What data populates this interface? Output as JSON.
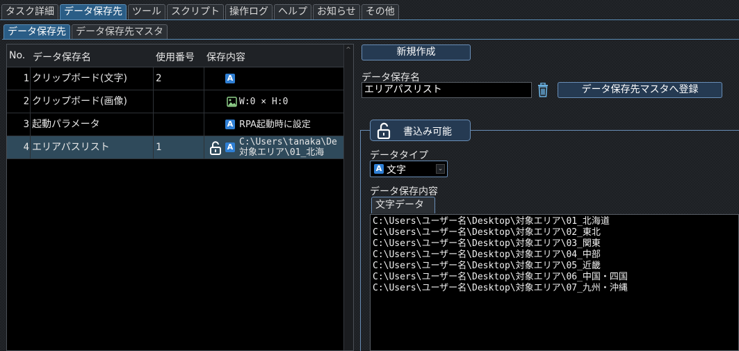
{
  "tabs": [
    "タスク詳細",
    "データ保存先",
    "ツール",
    "スクリプト",
    "操作ログ",
    "ヘルプ",
    "お知らせ",
    "その他"
  ],
  "subtabs": [
    "データ保存先",
    "データ保存先マスタ"
  ],
  "table": {
    "headers": {
      "no": "No.",
      "name": "データ保存名",
      "num": "使用番号",
      "content": "保存内容"
    },
    "rows": [
      {
        "no": "1",
        "name": "クリップボード(文字)",
        "num": "2",
        "icon": "text-type-icon",
        "content": ""
      },
      {
        "no": "2",
        "name": "クリップボード(画像)",
        "num": "",
        "icon": "image-icon",
        "content": "W:0 × H:0"
      },
      {
        "no": "3",
        "name": "起動パラメータ",
        "num": "",
        "icon": "text-type-icon",
        "content": "RPA起動時に設定"
      },
      {
        "no": "4",
        "name": "エリアパスリスト",
        "num": "1",
        "icon": "text-type-icon",
        "content_line1": "C:\\Users\\tanaka\\De",
        "content_line2": "対象エリア\\01_北海"
      }
    ]
  },
  "right": {
    "new_button": "新規作成",
    "name_label": "データ保存名",
    "name_value": "エリアパスリスト",
    "register_button": "データ保存先マスタへ登録",
    "lock_button": "書込み可能",
    "datatype_label": "データタイプ",
    "datatype_value": "文字",
    "content_label": "データ保存内容",
    "content_tab": "文字データ",
    "lines": [
      "C:\\Users\\ユーザー名\\Desktop\\対象エリア\\01_北海道",
      "C:\\Users\\ユーザー名\\Desktop\\対象エリア\\02_東北",
      "C:\\Users\\ユーザー名\\Desktop\\対象エリア\\03_関東",
      "C:\\Users\\ユーザー名\\Desktop\\対象エリア\\04_中部",
      "C:\\Users\\ユーザー名\\Desktop\\対象エリア\\05_近畿",
      "C:\\Users\\ユーザー名\\Desktop\\対象エリア\\06_中国・四国",
      "C:\\Users\\ユーザー名\\Desktop\\対象エリア\\07_九州・沖縄"
    ]
  },
  "colors": {
    "accent": "#2a5d86",
    "border": "#6a8fb8",
    "a_icon": "#2f7fd4"
  }
}
